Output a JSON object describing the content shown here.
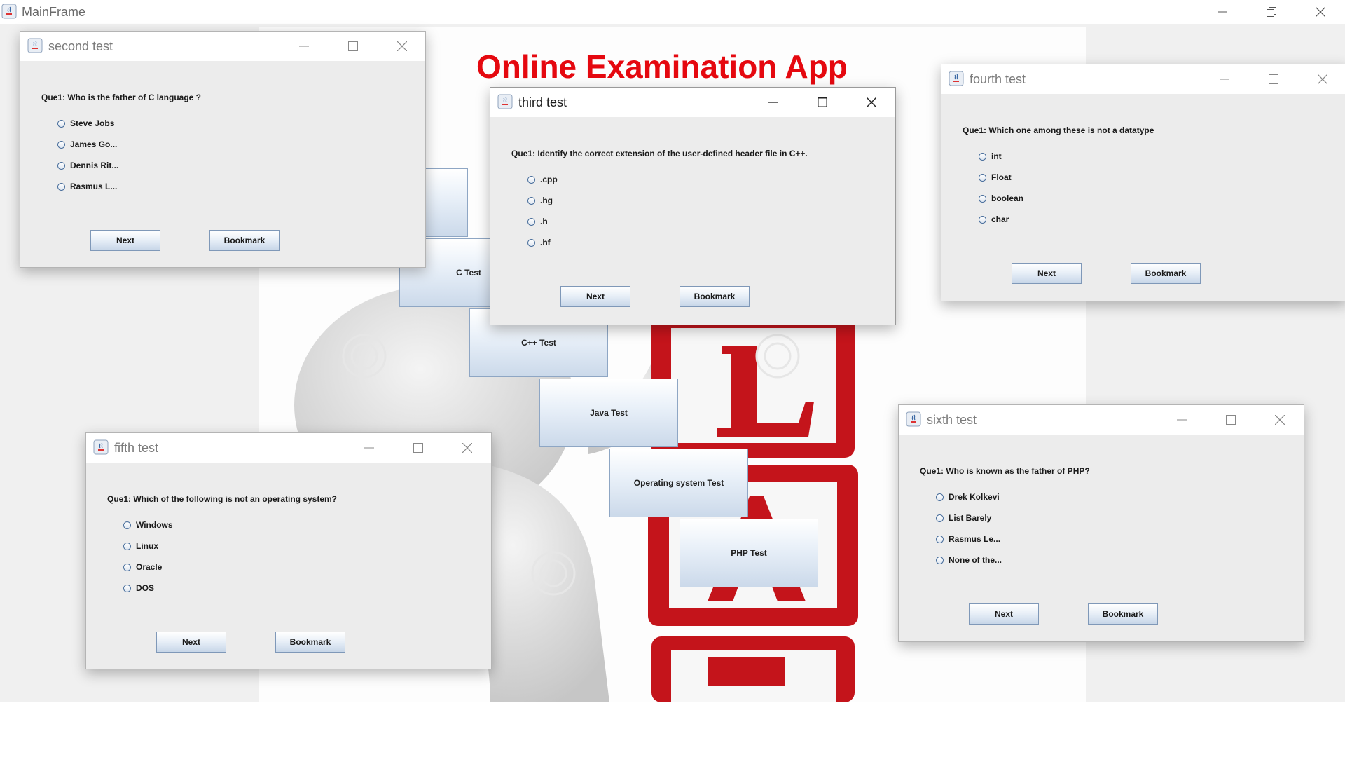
{
  "main_frame": {
    "title": "MainFrame"
  },
  "banner": {
    "title": "Online Examination App",
    "color": "#e5080f"
  },
  "tests": [
    {
      "label": "C Test"
    },
    {
      "label": "C++ Test"
    },
    {
      "label": "Java Test"
    },
    {
      "label": "Operating system Test"
    },
    {
      "label": "PHP Test"
    }
  ],
  "windows": {
    "second": {
      "title": "second test",
      "question": "Que1: Who is the father of C language ?",
      "options": [
        "Steve Jobs",
        "James Go...",
        "Dennis Rit...",
        "Rasmus L..."
      ],
      "next_label": "Next",
      "bookmark_label": "Bookmark"
    },
    "third": {
      "title": "third test",
      "question": "Que1: Identify the correct extension of the user-defined header file in C++.",
      "options": [
        ".cpp",
        ".hg",
        ".h",
        ".hf"
      ],
      "next_label": "Next",
      "bookmark_label": "Bookmark"
    },
    "fourth": {
      "title": "fourth test",
      "question": "Que1: Which one among these is not a datatype",
      "options": [
        "int",
        "Float",
        "boolean",
        "char"
      ],
      "next_label": "Next",
      "bookmark_label": "Bookmark"
    },
    "fifth": {
      "title": "fifth test",
      "question": "Que1:  Which of the following is not an operating system?",
      "options": [
        "Windows",
        "Linux",
        "Oracle",
        "DOS"
      ],
      "next_label": "Next",
      "bookmark_label": "Bookmark"
    },
    "sixth": {
      "title": "sixth test",
      "question": "Que1: Who is known as the father of PHP?",
      "options": [
        "Drek Kolkevi",
        "List Barely",
        "Rasmus Le...",
        "None of the..."
      ],
      "next_label": "Next",
      "bookmark_label": "Bookmark"
    }
  }
}
